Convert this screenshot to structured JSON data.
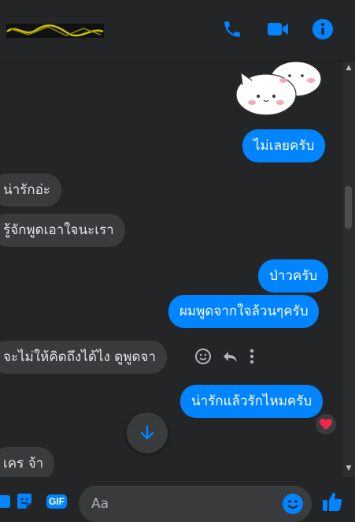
{
  "header": {
    "contact_name": "",
    "icons": [
      "phone-icon",
      "video-icon",
      "info-icon"
    ]
  },
  "messages": [
    {
      "side": "out",
      "type": "sticker",
      "description": "sticker"
    },
    {
      "side": "out",
      "text": "ไม่เลยครับ"
    },
    {
      "side": "in",
      "text": "น่ารักอ่ะ"
    },
    {
      "side": "in",
      "text": "รู้จักพูดเอาใจนะเรา"
    },
    {
      "side": "out",
      "text": "ป่าวครับ"
    },
    {
      "side": "out",
      "text": "ผมพูดจากใจล้วนๆครับ"
    },
    {
      "side": "in",
      "text": "จะไม่ให้คิดถึงได้ไง ดูพูดจา"
    },
    {
      "side": "out",
      "text": "น่ารักแล้วรักไหมครับ",
      "reaction": "❤"
    },
    {
      "side": "in",
      "text": "เคร จ้า"
    }
  ],
  "composer": {
    "placeholder": "Aa"
  },
  "footer": {
    "gif_label": "GIF"
  },
  "colors": {
    "accent": "#0084ff",
    "background": "#242526",
    "incoming_bubble": "#3a3b3c",
    "reaction_heart": "#f02849"
  }
}
